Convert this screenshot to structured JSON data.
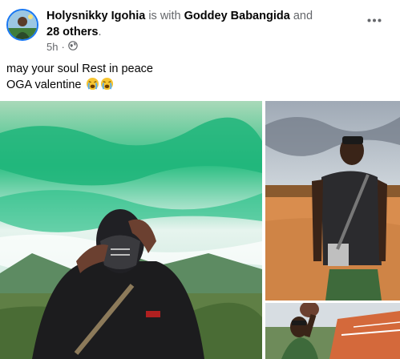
{
  "post": {
    "author": "Holysnikky Igohia",
    "with_text": "is with",
    "tagged": "Goddey Babangida",
    "and_text": "and",
    "others": "28 others",
    "period": ".",
    "time": "5h",
    "privacy_icon": "globe-icon",
    "more_icon": "more-dots-icon",
    "caption_line1": "may your soul Rest in peace",
    "caption_line2": "OGA valentine",
    "caption_emoji": "crying-face-emoji"
  },
  "photos": [
    {
      "name": "masked-man-photo"
    },
    {
      "name": "standing-man-photo"
    },
    {
      "name": "waving-man-photo"
    }
  ],
  "colors": {
    "accent": "#1877f2",
    "muted_text": "#65676b",
    "primary_text": "#050505"
  }
}
